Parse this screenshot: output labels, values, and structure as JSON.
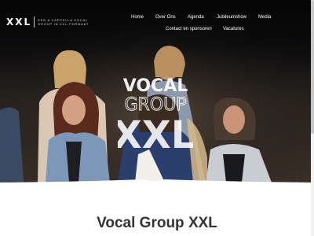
{
  "site": {
    "logo_mark": "XXL",
    "logo_tagline_line1": "EEN A CAPPELLA VOCAL",
    "logo_tagline_line2": "GROUP IN XXL-FORMAAT"
  },
  "nav": {
    "items": [
      {
        "label": "Home"
      },
      {
        "label": "Over Ons"
      },
      {
        "label": "Agenda"
      },
      {
        "label": "Jubileumshow"
      },
      {
        "label": "Media"
      },
      {
        "label": "Contact en sponsoren"
      },
      {
        "label": "Vacatures"
      }
    ]
  },
  "hero": {
    "overlay_line1": "VOCAL",
    "overlay_line2": "GROUP",
    "overlay_line3": "XXL"
  },
  "main": {
    "title": "Vocal Group XXL"
  },
  "colors": {
    "hero_bg": "#0b0b0d",
    "nav_text": "#ffffff",
    "title_text": "#333333"
  }
}
